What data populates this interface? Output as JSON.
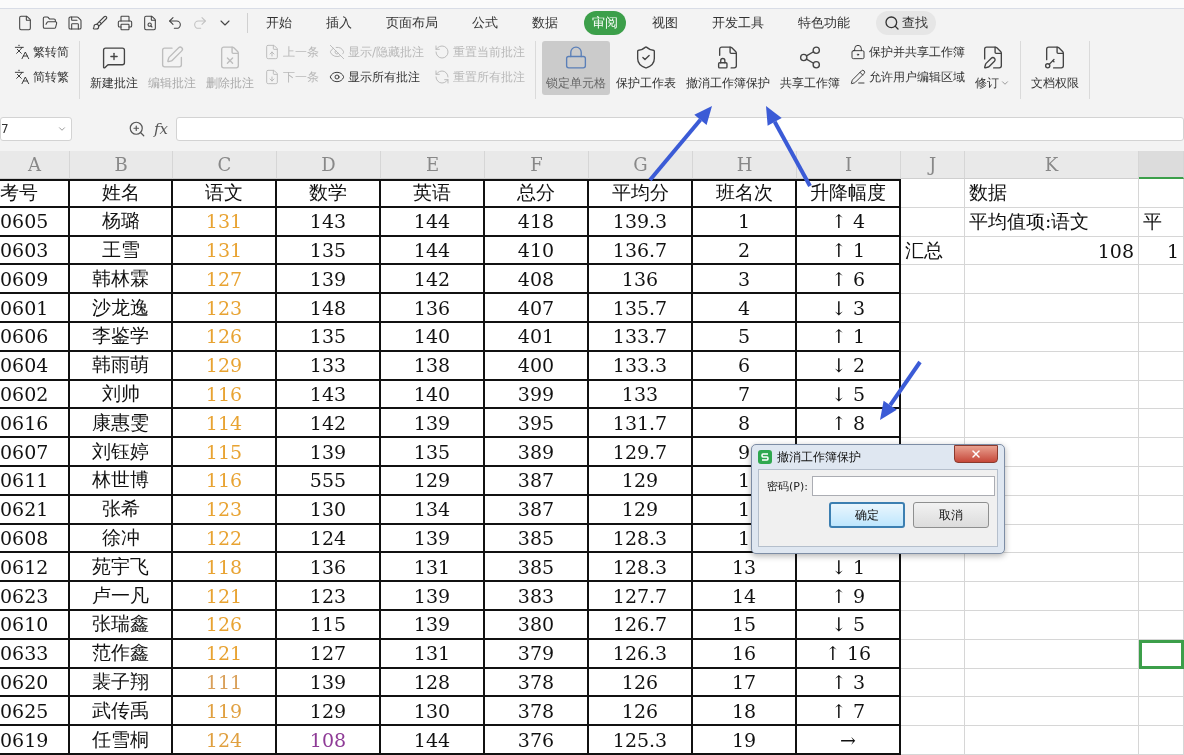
{
  "quick_access": [
    {
      "disabled": false
    },
    {
      "disabled": false
    },
    {
      "disabled": false
    },
    {
      "disabled": false
    },
    {
      "disabled": false
    },
    {
      "disabled": false
    },
    {
      "disabled": false
    },
    {
      "disabled": true
    },
    {
      "disabled": false
    }
  ],
  "menu_tabs": [
    {
      "label": "开始",
      "selected": false
    },
    {
      "label": "插入",
      "selected": false
    },
    {
      "label": "页面布局",
      "selected": false
    },
    {
      "label": "公式",
      "selected": false
    },
    {
      "label": "数据",
      "selected": false
    },
    {
      "label": "审阅",
      "selected": true
    },
    {
      "label": "视图",
      "selected": false
    },
    {
      "label": "开发工具",
      "selected": false
    },
    {
      "label": "特色功能",
      "selected": false
    }
  ],
  "search": {
    "label": "查找"
  },
  "ribbon": {
    "groups": [
      {
        "columns": [
          {
            "kind": "stack",
            "items": [
              {
                "label": "繁转简",
                "disabled": false
              },
              {
                "label": "简转繁",
                "disabled": false
              }
            ]
          }
        ]
      },
      {
        "columns": [
          {
            "kind": "large",
            "label": "新建批注",
            "disabled": false,
            "pressed": false,
            "dropdown": false
          },
          {
            "kind": "large",
            "label": "编辑批注",
            "disabled": true,
            "pressed": false,
            "dropdown": false
          },
          {
            "kind": "large",
            "label": "删除批注",
            "disabled": true,
            "pressed": false,
            "dropdown": false
          },
          {
            "kind": "stack",
            "items": [
              {
                "label": "上一条",
                "disabled": true
              },
              {
                "label": "下一条",
                "disabled": true
              }
            ]
          },
          {
            "kind": "stack",
            "items": [
              {
                "label": "显示/隐藏批注",
                "disabled": true
              },
              {
                "label": "显示所有批注",
                "disabled": false
              }
            ]
          },
          {
            "kind": "stack",
            "items": [
              {
                "label": "重置当前批注",
                "disabled": true
              },
              {
                "label": "重置所有批注",
                "disabled": true
              }
            ]
          }
        ]
      },
      {
        "columns": [
          {
            "kind": "large",
            "label": "锁定单元格",
            "disabled": false,
            "pressed": true,
            "dropdown": false
          },
          {
            "kind": "large",
            "label": "保护工作表",
            "disabled": false,
            "pressed": false,
            "dropdown": false
          },
          {
            "kind": "large",
            "label": "撤消工作簿保护",
            "disabled": false,
            "pressed": false,
            "dropdown": false
          },
          {
            "kind": "large",
            "label": "共享工作簿",
            "disabled": false,
            "pressed": false,
            "dropdown": false
          },
          {
            "kind": "stack",
            "items": [
              {
                "label": "保护并共享工作簿",
                "disabled": false
              },
              {
                "label": "允许用户编辑区域",
                "disabled": false
              }
            ]
          },
          {
            "kind": "large",
            "label": "修订",
            "disabled": false,
            "pressed": false,
            "dropdown": true
          }
        ]
      },
      {
        "columns": [
          {
            "kind": "large",
            "label": "文档权限",
            "disabled": false,
            "pressed": false,
            "dropdown": false
          }
        ]
      }
    ]
  },
  "formula_bar": {
    "name_box": "7",
    "function_label": "fx"
  },
  "sheet": {
    "columns": [
      {
        "label": "A",
        "selected": false
      },
      {
        "label": "B",
        "selected": false
      },
      {
        "label": "C",
        "selected": false
      },
      {
        "label": "D",
        "selected": false
      },
      {
        "label": "E",
        "selected": false
      },
      {
        "label": "F",
        "selected": false
      },
      {
        "label": "G",
        "selected": false
      },
      {
        "label": "H",
        "selected": false
      },
      {
        "label": "I",
        "selected": false
      },
      {
        "label": "J",
        "selected": false
      },
      {
        "label": "K",
        "selected": false
      },
      {
        "selected": true
      }
    ],
    "rows": [
      {
        "cells": [
          "考号",
          "姓名",
          "语文",
          "数学",
          "英语",
          "总分",
          "平均分",
          "班名次",
          "升降幅度",
          null,
          "数据"
        ]
      },
      {
        "cells": [
          "0605",
          "杨璐",
          {
            "text": "131",
            "color": "#e8a332"
          },
          "143",
          "144",
          "418",
          "139.3",
          "1",
          "↑ 4",
          null,
          "平均值项:语文",
          "平"
        ]
      },
      {
        "cells": [
          "0603",
          "王雪",
          {
            "text": "131",
            "color": "#e8a332"
          },
          "135",
          "144",
          "410",
          "136.7",
          "2",
          "↑ 1",
          "汇总",
          "108",
          "1"
        ]
      },
      {
        "cells": [
          "0609",
          "韩林霖",
          {
            "text": "127",
            "color": "#e8a332"
          },
          "139",
          "142",
          "408",
          "136",
          "3",
          "↑ 6"
        ]
      },
      {
        "cells": [
          "0601",
          "沙龙逸",
          {
            "text": "123",
            "color": "#e8a332"
          },
          "148",
          "136",
          "407",
          "135.7",
          "4",
          "↓ 3"
        ]
      },
      {
        "cells": [
          "0606",
          "李鉴学",
          {
            "text": "126",
            "color": "#e8a332"
          },
          "135",
          "140",
          "401",
          "133.7",
          "5",
          "↑ 1"
        ]
      },
      {
        "cells": [
          "0604",
          "韩雨萌",
          {
            "text": "129",
            "color": "#e8a332"
          },
          "133",
          "138",
          "400",
          "133.3",
          "6",
          "↓ 2"
        ]
      },
      {
        "cells": [
          "0602",
          "刘帅",
          {
            "text": "116",
            "color": "#e8a332"
          },
          "143",
          "140",
          "399",
          "133",
          "7",
          "↓ 5"
        ]
      },
      {
        "cells": [
          "0616",
          "康惠雯",
          {
            "text": "114",
            "color": "#e8a332"
          },
          "142",
          "139",
          "395",
          "131.7",
          "8",
          "↑ 8"
        ]
      },
      {
        "cells": [
          "0607",
          "刘钰婷",
          {
            "text": "115",
            "color": "#e8a332"
          },
          "139",
          "135",
          "389",
          "129.7",
          "9"
        ]
      },
      {
        "cells": [
          "0611",
          "林世博",
          {
            "text": "116",
            "color": "#e8a332"
          },
          "555",
          "129",
          "387",
          "129",
          "1"
        ]
      },
      {
        "cells": [
          "0621",
          "张希",
          {
            "text": "123",
            "color": "#e8a332"
          },
          "130",
          "134",
          "387",
          "129",
          "1"
        ]
      },
      {
        "cells": [
          "0608",
          "徐冲",
          {
            "text": "122",
            "color": "#e8a332"
          },
          "124",
          "139",
          "385",
          "128.3",
          "1"
        ]
      },
      {
        "cells": [
          "0612",
          "苑宇飞",
          {
            "text": "118",
            "color": "#e8a332"
          },
          "136",
          "131",
          "385",
          "128.3",
          "13",
          "↓ 1"
        ]
      },
      {
        "cells": [
          "0623",
          "卢一凡",
          {
            "text": "121",
            "color": "#e8a332"
          },
          "123",
          "139",
          "383",
          "127.7",
          "14",
          "↑ 9"
        ]
      },
      {
        "cells": [
          "0610",
          "张瑞鑫",
          {
            "text": "126",
            "color": "#e8a332"
          },
          "115",
          "139",
          "380",
          "126.7",
          "15",
          "↓ 5"
        ]
      },
      {
        "cells": [
          "0633",
          "范作鑫",
          {
            "text": "121",
            "color": "#e8a332"
          },
          "127",
          "131",
          "379",
          "126.3",
          "16",
          "↑ 16",
          null,
          null,
          {
            "selected": true
          }
        ]
      },
      {
        "cells": [
          "0620",
          "裴子翔",
          {
            "text": "111",
            "color": "#d9a05a"
          },
          "139",
          "128",
          "378",
          "126",
          "17",
          "↑ 3"
        ]
      },
      {
        "cells": [
          "0625",
          "武传禹",
          {
            "text": "119",
            "color": "#e0a040"
          },
          "129",
          "130",
          "378",
          "126",
          "18",
          "↑ 7"
        ]
      },
      {
        "cells": [
          "0619",
          "任雪桐",
          {
            "text": "124",
            "color": "#e0a040"
          },
          {
            "text": "108",
            "color": "#8e3a96"
          },
          "144",
          "376",
          "125.3",
          "19",
          "→"
        ]
      }
    ]
  },
  "dialog": {
    "title": "撤消工作簿保护",
    "field_label": "密码(P):",
    "buttons": [
      {
        "label": "确定",
        "focused": true
      },
      {
        "label": "取消",
        "focused": false
      }
    ]
  }
}
